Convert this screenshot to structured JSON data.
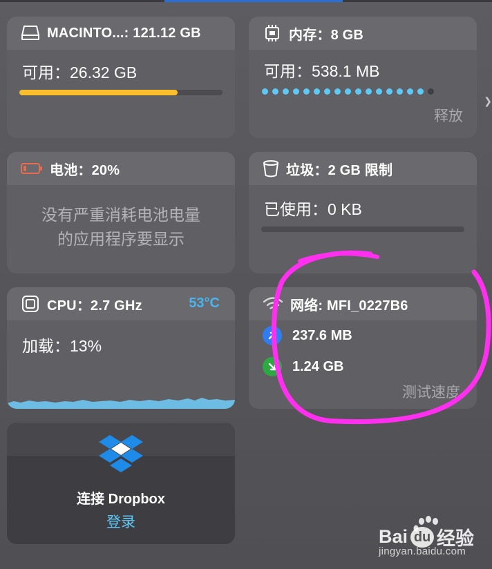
{
  "disk": {
    "title": "MACINTO...: 121.12 GB",
    "available": "可用：26.32 GB",
    "used_fraction": 0.78
  },
  "memory": {
    "title": "内存：8 GB",
    "available": "可用：538.1 MB",
    "release": "释放",
    "dots_total": 17,
    "dots_on": 16
  },
  "battery": {
    "title": "电池：20%",
    "message_line1": "没有严重消耗电池电量",
    "message_line2": "的应用程序要显示",
    "level_fraction": 0.2
  },
  "trash": {
    "title": "垃圾：2 GB 限制",
    "used": "已使用：0 KB",
    "used_fraction": 0
  },
  "cpu": {
    "title": "CPU：2.7 GHz",
    "temp": "53°C",
    "load": "加载：13%"
  },
  "network": {
    "title": "网络: MFI_0227B6",
    "upload": "237.6 MB",
    "download": "1.24 GB",
    "speedtest": "测试速度"
  },
  "dropbox": {
    "connect": "连接 Dropbox",
    "login": "登录"
  },
  "watermark": {
    "brand": "Bai",
    "brand_tail": "经验",
    "site": "jingyan.baidu.com"
  },
  "colors": {
    "disk_bar": "#fbbf2b",
    "memory_dot": "#5ec8f6",
    "battery": "#e86b50",
    "upload": "#2f7df0",
    "download": "#2ea843",
    "annotation": "#ff2ff0"
  }
}
